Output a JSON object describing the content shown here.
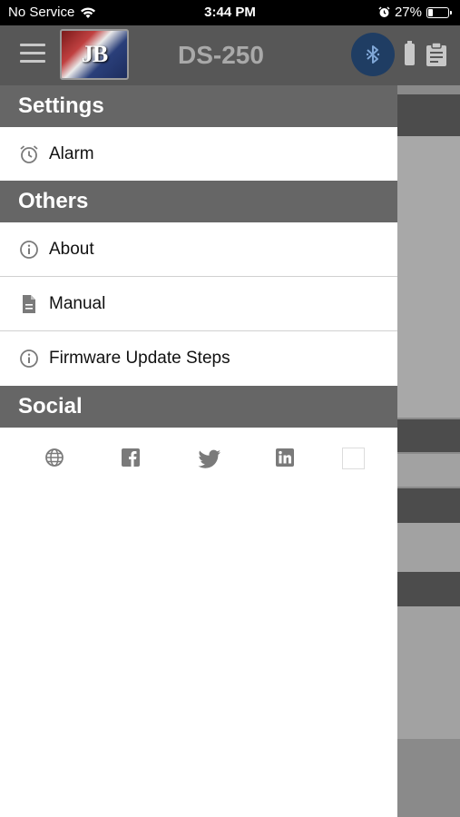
{
  "status_bar": {
    "carrier": "No Service",
    "time": "3:44 PM",
    "battery_percent": "27%",
    "battery_level": 0.27,
    "icons": [
      "wifi-icon",
      "alarm-clock-icon",
      "battery-icon"
    ]
  },
  "header": {
    "title": "DS-250",
    "logo_text": "JB",
    "icons": [
      "hamburger-menu-icon",
      "logo",
      "bluetooth-icon",
      "device-battery-icon",
      "clipboard-icon"
    ]
  },
  "drawer": {
    "sections": [
      {
        "title": "Settings",
        "items": [
          {
            "label": "Alarm",
            "icon": "alarm-clock-icon"
          }
        ]
      },
      {
        "title": "Others",
        "items": [
          {
            "label": "About",
            "icon": "info-icon"
          },
          {
            "label": "Manual",
            "icon": "document-icon"
          },
          {
            "label": "Firmware Update Steps",
            "icon": "info-icon"
          }
        ]
      },
      {
        "title": "Social",
        "items": []
      }
    ],
    "social_icons": [
      "globe-icon",
      "facebook-icon",
      "twitter-icon",
      "linkedin-icon",
      "blank-icon"
    ]
  },
  "colors": {
    "status_bar": "#000000",
    "app_header": "#575757",
    "section_header": "#666666",
    "bluetooth_button": "#1f3d63",
    "drawer_bg": "#ffffff",
    "icon_gray": "#7a7a7a"
  }
}
